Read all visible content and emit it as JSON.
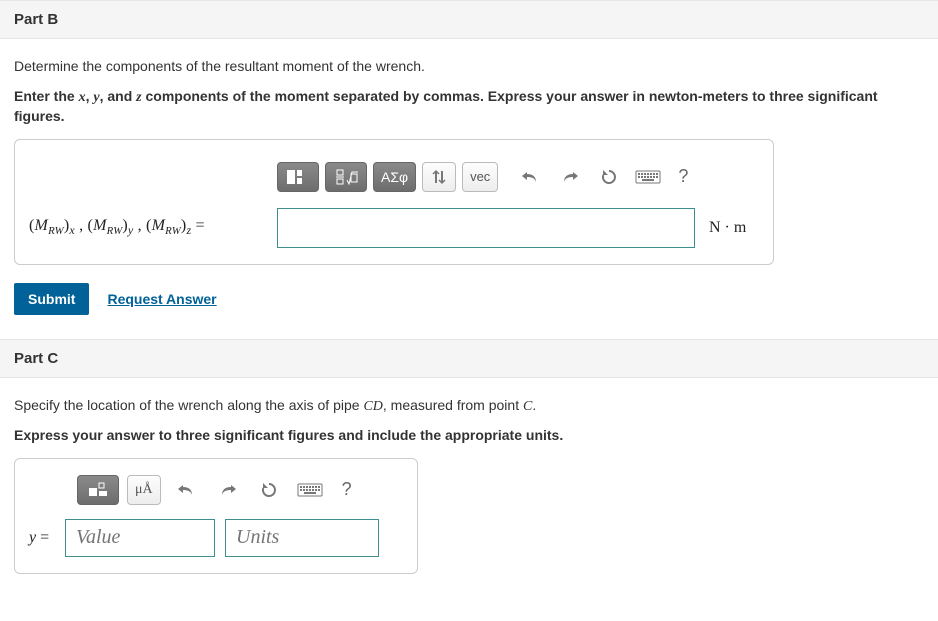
{
  "partB": {
    "heading": "Part B",
    "prompt": "Determine the components of the resultant moment of the wrench.",
    "instructions_pre": "Enter the ",
    "var_x": "x",
    "var_sep1": ", ",
    "var_y": "y",
    "var_sep2": ", and ",
    "var_z": "z",
    "instructions_post": " components of the moment separated by commas. Express your answer in newton-meters to three significant figures.",
    "toolbar": {
      "templates_icon": "templates-icon",
      "fraction_icon": "fraction-root-icon",
      "greek_label": "ΑΣφ",
      "subsup_icon": "subsup-icon",
      "vec_label": "vec",
      "undo_icon": "undo-icon",
      "redo_icon": "redo-icon",
      "reset_icon": "reset-icon",
      "keyboard_icon": "keyboard-icon",
      "help_label": "?"
    },
    "answer_label_html": "(MRW)x , (MRW)y , (MRW)z =",
    "input_value": "",
    "units": "N · m",
    "submit_label": "Submit",
    "request_label": "Request Answer"
  },
  "partC": {
    "heading": "Part C",
    "prompt_pre": "Specify the location of the wrench along the axis of pipe ",
    "prompt_cd": "CD",
    "prompt_mid": ", measured from point ",
    "prompt_c": "C",
    "prompt_post": ".",
    "instructions": "Express your answer to three significant figures and include the appropriate units.",
    "toolbar": {
      "templates_icon": "templates-icon",
      "units_label": "μÅ",
      "undo_icon": "undo-icon",
      "redo_icon": "redo-icon",
      "reset_icon": "reset-icon",
      "keyboard_icon": "keyboard-icon",
      "help_label": "?"
    },
    "lhs": "y =",
    "value_placeholder": "Value",
    "units_placeholder": "Units"
  }
}
